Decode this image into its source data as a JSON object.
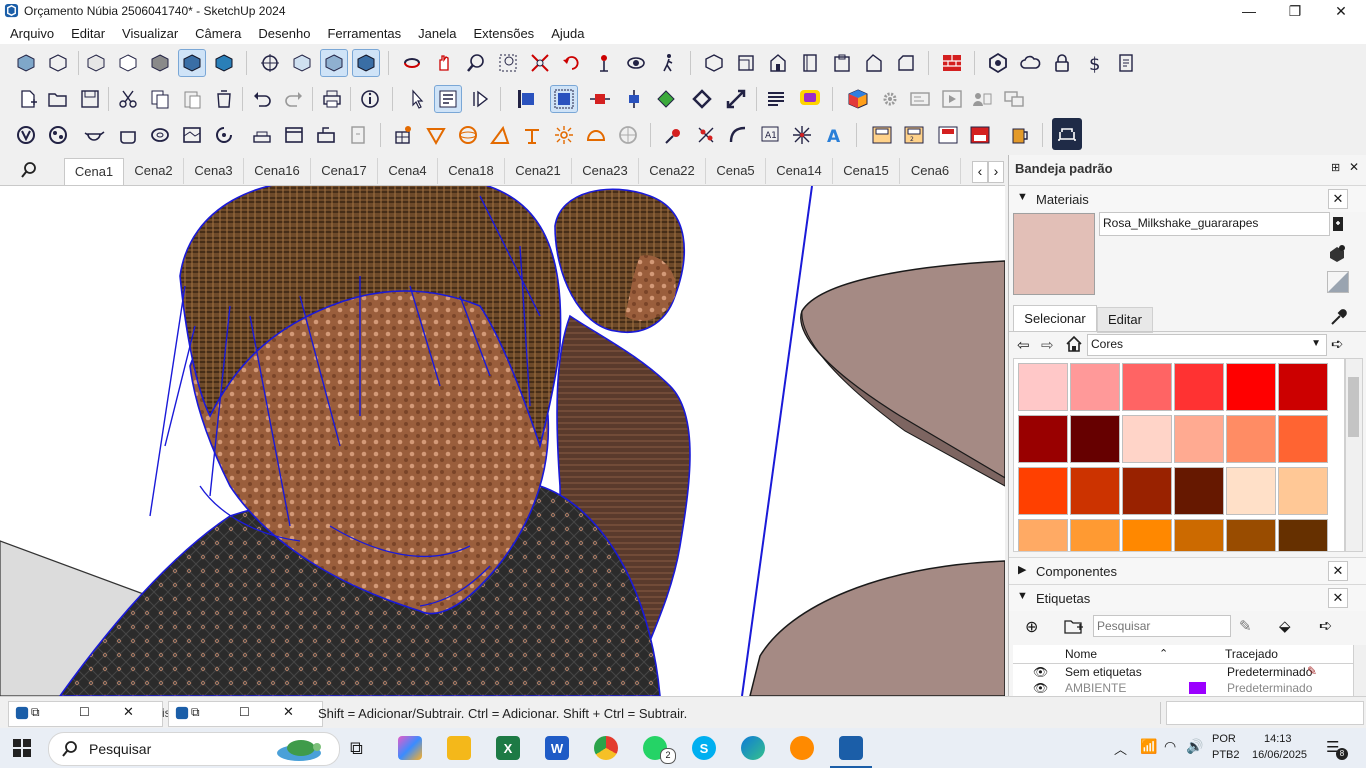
{
  "window": {
    "title": "Orçamento Núbia 2506041740* - SketchUp 2024",
    "controls": {
      "minimize": "—",
      "maximize": "❐",
      "close": "✕"
    }
  },
  "menu": [
    "Arquivo",
    "Editar",
    "Visualizar",
    "Câmera",
    "Desenho",
    "Ferramentas",
    "Janela",
    "Extensões",
    "Ajuda"
  ],
  "scenes": {
    "tabs": [
      "Cena1",
      "Cena2",
      "Cena3",
      "Cena16",
      "Cena17",
      "Cena4",
      "Cena18",
      "Cena21",
      "Cena23",
      "Cena22",
      "Cena5",
      "Cena14",
      "Cena15",
      "Cena6"
    ],
    "active": "Cena1",
    "nav_left": "‹",
    "nav_right": "›"
  },
  "tray": {
    "title": "Bandeja padrão",
    "materials": {
      "header": "Materiais",
      "current_name": "Rosa_Milkshake_guararapes",
      "current_color": "#e2bfb7",
      "tab_select": "Selecionar",
      "tab_edit": "Editar",
      "library": "Cores",
      "swatches": [
        "#ffc8c8",
        "#ff9999",
        "#ff6464",
        "#ff3232",
        "#ff0000",
        "#cc0000",
        "#990000",
        "#660000",
        "#ffd4c8",
        "#ffaa91",
        "#ff8c64",
        "#ff6432",
        "#ff4000",
        "#cc3300",
        "#992200",
        "#661800",
        "#ffe0c8",
        "#ffc896",
        "#ffaa64",
        "#ff9a32",
        "#ff8800",
        "#cc6a00",
        "#994c00",
        "#663000"
      ]
    },
    "components": {
      "header": "Componentes"
    },
    "tags": {
      "header": "Etiquetas",
      "search_placeholder": "Pesquisar",
      "col_name": "Nome",
      "col_dash": "Tracejado",
      "rows": [
        {
          "name": "Sem etiquetas",
          "dash": "Predeterminado",
          "color": ""
        },
        {
          "name": "AMBIENTE",
          "dash": "Predeterminado",
          "color": "#9b00ff"
        }
      ]
    }
  },
  "status": {
    "hint": "Shift = Adicionar/Subtrair. Ctrl = Adicionar. Shift + Ctrl = Subtrair.",
    "partial_label": "iste"
  },
  "taskbar": {
    "search": "Pesquisar",
    "language": "POR",
    "layout": "PTB2",
    "time": "14:13",
    "date": "16/06/2025",
    "notifications": "8",
    "whatsapp_badge": "2"
  }
}
